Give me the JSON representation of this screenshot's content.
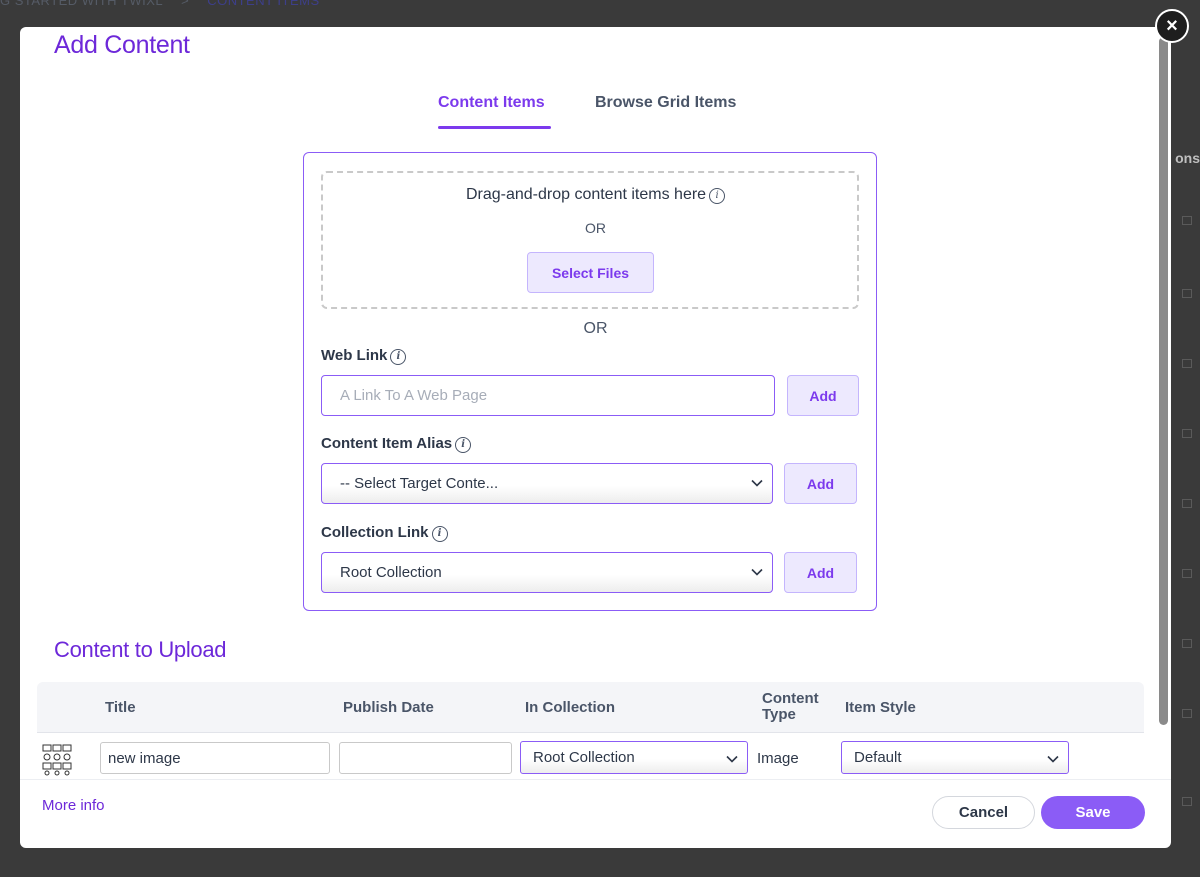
{
  "background": {
    "breadcrumb_parent": "G STARTED WITH TWIXL",
    "breadcrumb_separator": ">",
    "breadcrumb_current": "CONTENT ITEMS",
    "column_header_fragment": "ons"
  },
  "modal": {
    "title": "Add Content",
    "close_label": "×",
    "tabs": [
      {
        "label": "Content Items",
        "active": true
      },
      {
        "label": "Browse Grid Items",
        "active": false
      }
    ]
  },
  "upload": {
    "drop_text": "Drag-and-drop content items here",
    "or_small": "OR",
    "select_files_label": "Select Files",
    "or_big": "OR",
    "web_link": {
      "label": "Web Link",
      "placeholder": "A Link To A Web Page",
      "add_label": "Add"
    },
    "alias": {
      "label": "Content Item Alias",
      "selected": "-- Select Target Conte...",
      "add_label": "Add"
    },
    "collection_link": {
      "label": "Collection Link",
      "selected": "Root Collection",
      "add_label": "Add"
    }
  },
  "content_to_upload": {
    "title": "Content to Upload",
    "columns": [
      "Title",
      "Publish Date",
      "In Collection",
      "Content Type",
      "Item Style"
    ],
    "rows": [
      {
        "title": "new image",
        "publish_date": "",
        "in_collection": "Root Collection",
        "content_type": "Image",
        "item_style": "Default"
      }
    ]
  },
  "footer": {
    "more_info": "More info",
    "cancel_label": "Cancel",
    "save_label": "Save"
  },
  "colors": {
    "accent": "#7c3aed",
    "accent_light": "#ede9fe",
    "overlay": "#3a3a3a"
  },
  "icons": [
    "close-icon",
    "info-icon",
    "chevron-down-icon",
    "image-thumbnail"
  ]
}
